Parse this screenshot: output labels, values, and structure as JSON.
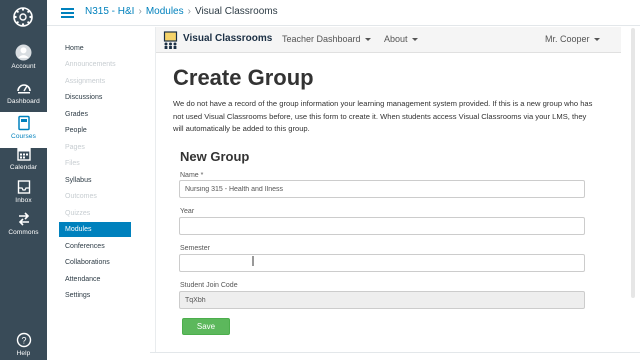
{
  "global_nav": {
    "logo_icon": "canvas-logo-icon",
    "items": [
      {
        "label": "Account",
        "icon": "account-icon"
      },
      {
        "label": "Dashboard",
        "icon": "dashboard-icon"
      },
      {
        "label": "Courses",
        "icon": "courses-icon",
        "active": true
      },
      {
        "label": "Calendar",
        "icon": "calendar-icon"
      },
      {
        "label": "Inbox",
        "icon": "inbox-icon"
      },
      {
        "label": "Commons",
        "icon": "commons-icon"
      },
      {
        "label": "Help",
        "icon": "help-icon"
      }
    ]
  },
  "breadcrumb": {
    "course": "N315 - H&I",
    "section": "Modules",
    "current": "Visual Classrooms"
  },
  "course_nav": {
    "items": [
      {
        "label": "Home",
        "disabled": false
      },
      {
        "label": "Announcements",
        "disabled": true
      },
      {
        "label": "Assignments",
        "disabled": true
      },
      {
        "label": "Discussions",
        "disabled": false
      },
      {
        "label": "Grades",
        "disabled": false
      },
      {
        "label": "People",
        "disabled": false
      },
      {
        "label": "Pages",
        "disabled": true
      },
      {
        "label": "Files",
        "disabled": true
      },
      {
        "label": "Syllabus",
        "disabled": false
      },
      {
        "label": "Outcomes",
        "disabled": true
      },
      {
        "label": "Quizzes",
        "disabled": true
      },
      {
        "label": "Modules",
        "disabled": false,
        "active": true
      },
      {
        "label": "Conferences",
        "disabled": false
      },
      {
        "label": "Collaborations",
        "disabled": false
      },
      {
        "label": "Attendance",
        "disabled": false
      },
      {
        "label": "Settings",
        "disabled": false
      }
    ]
  },
  "tool": {
    "brand": "Visual Classrooms",
    "menu": {
      "teacher_dashboard": "Teacher Dashboard",
      "about": "About",
      "user": "Mr. Cooper"
    },
    "page_title": "Create Group",
    "intro": "We do not have a record of the group information your learning management system provided. If this is a new group who has not used Visual Classrooms before, use this form to create it. When students access Visual Classrooms via your LMS, they will automatically be added to this group.",
    "section_title": "New Group",
    "fields": {
      "name_label": "Name *",
      "name_value": "Nursing 315 - Health and Ilness",
      "year_label": "Year",
      "year_value": "",
      "semester_label": "Semester",
      "semester_value": "",
      "join_code_label": "Student Join Code",
      "join_code_value": "TqXbh"
    },
    "save_label": "Save"
  },
  "colors": {
    "global_nav_bg": "#394b58",
    "accent": "#0081bd",
    "save_green": "#5cb85c"
  }
}
